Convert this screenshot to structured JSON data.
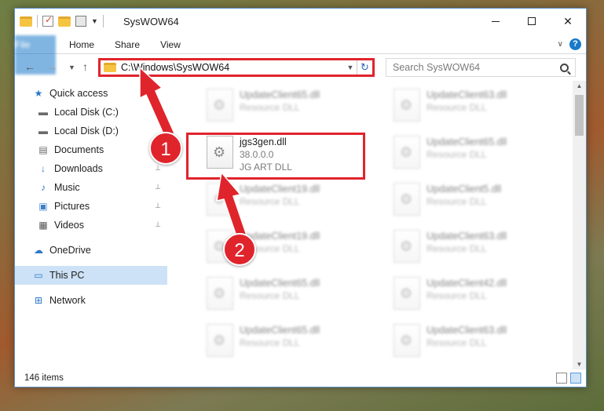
{
  "window": {
    "title": "SysWOW64",
    "controls": {
      "minimize": "",
      "maximize": "",
      "close": "✕"
    }
  },
  "ribbon": {
    "tabs": [
      "File",
      "Home",
      "Share",
      "View"
    ],
    "help": "?"
  },
  "address": {
    "path": "C:\\Windows\\SysWOW64",
    "search_placeholder": "Search SysWOW64"
  },
  "navpane": [
    {
      "label": "Quick access",
      "icon": "star-icon",
      "pinned": false
    },
    {
      "label": "Local Disk (C:)",
      "icon": "drive-icon",
      "pinned": true
    },
    {
      "label": "Local Disk (D:)",
      "icon": "drive-icon",
      "pinned": false
    },
    {
      "label": "Documents",
      "icon": "documents-icon",
      "pinned": true
    },
    {
      "label": "Downloads",
      "icon": "download-icon",
      "pinned": true
    },
    {
      "label": "Music",
      "icon": "music-icon",
      "pinned": true
    },
    {
      "label": "Pictures",
      "icon": "pictures-icon",
      "pinned": true
    },
    {
      "label": "Videos",
      "icon": "videos-icon",
      "pinned": true
    },
    {
      "label": "OneDrive",
      "icon": "cloud-icon",
      "pinned": false
    },
    {
      "label": "This PC",
      "icon": "computer-icon",
      "pinned": false,
      "selected": true
    },
    {
      "label": "Network",
      "icon": "network-icon",
      "pinned": false
    }
  ],
  "files": {
    "left": [
      {
        "name": "UpdateClient65.dll",
        "type": "Resource DLL"
      },
      {
        "name": "jgs3gen.dll",
        "type": "38.0.0.0",
        "desc": "JG ART DLL",
        "highlighted": true
      },
      {
        "name": "UpdateClient19.dll",
        "type": "Resource DLL"
      },
      {
        "name": "UpdateClient19.dll",
        "type": "Resource DLL"
      },
      {
        "name": "UpdateClient65.dll",
        "type": "Resource DLL"
      },
      {
        "name": "UpdateClient65.dll",
        "type": "Resource DLL"
      }
    ],
    "right": [
      {
        "name": "UpdateClient63.dll",
        "type": "Resource DLL"
      },
      {
        "name": "UpdateClient65.dll",
        "type": "Resource DLL"
      },
      {
        "name": "UpdateClient5.dll",
        "type": "Resource DLL"
      },
      {
        "name": "UpdateClient63.dll",
        "type": "Resource DLL"
      },
      {
        "name": "UpdateClient42.dll",
        "type": "Resource DLL"
      },
      {
        "name": "UpdateClient63.dll",
        "type": "Resource DLL"
      }
    ]
  },
  "status": {
    "count": "146 items"
  },
  "annotations": {
    "step1": "1",
    "step2": "2",
    "color": "#e0242c"
  }
}
